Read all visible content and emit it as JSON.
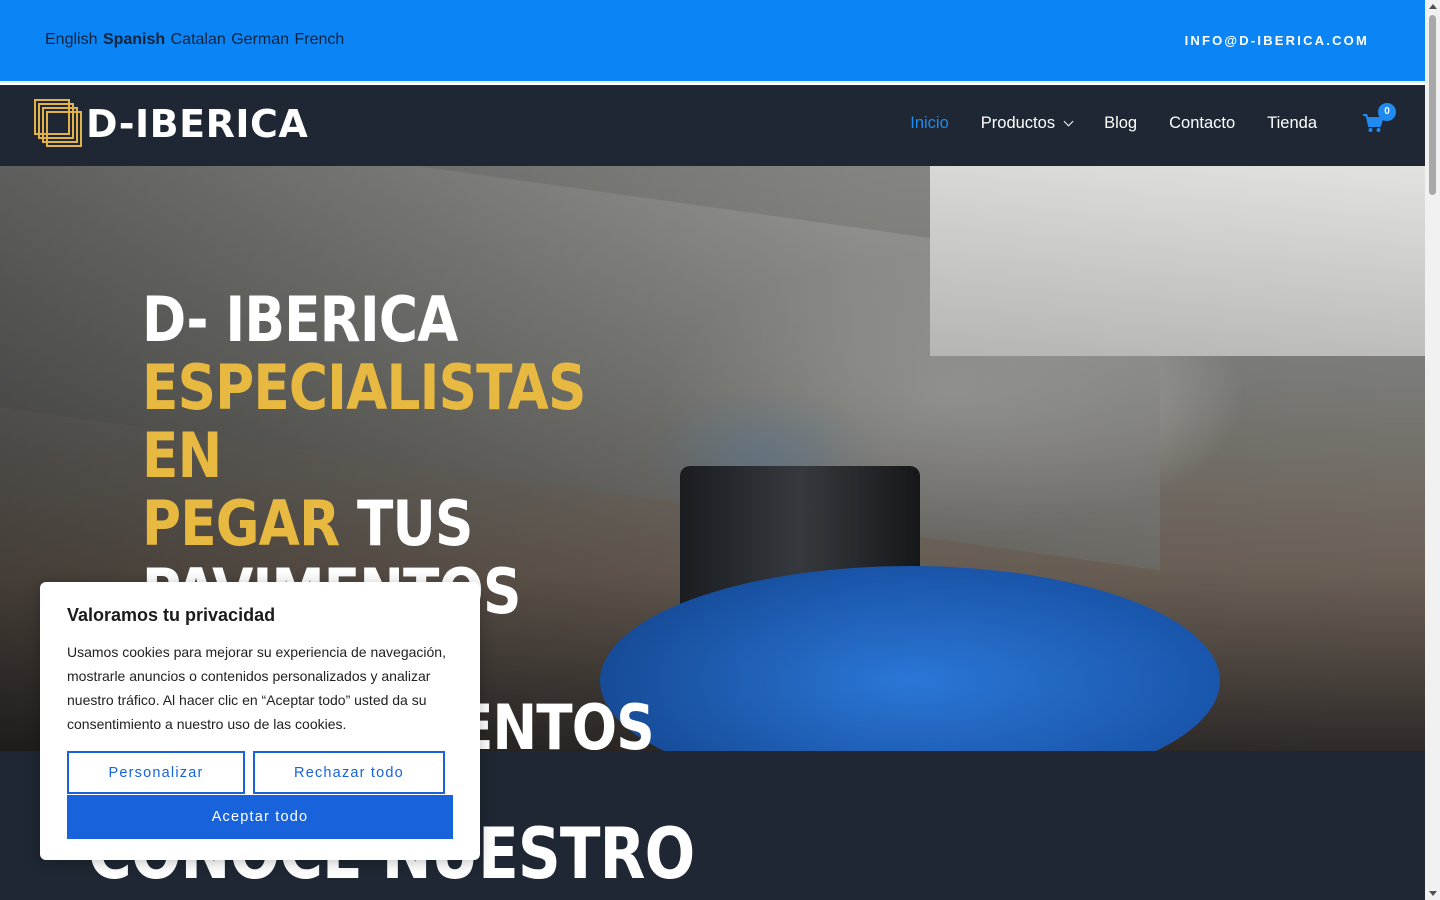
{
  "topbar": {
    "languages": [
      "English",
      "Spanish",
      "Catalan",
      "German",
      "French"
    ],
    "active_language": "Spanish",
    "email": "INFO@D-IBERICA.COM"
  },
  "header": {
    "logo_text": "D-IBERICA",
    "nav": [
      "Inicio",
      "Productos",
      "Blog",
      "Contacto",
      "Tienda"
    ],
    "current": "Inicio",
    "cart_count": "0"
  },
  "hero": {
    "line1": "D- IBERICA",
    "gold1": "ESPECIALISTAS EN",
    "gold2": "PEGAR",
    "white2": " TUS",
    "line3": "PAVIMENTOS Y",
    "line4": "REVESTIMIENTOS"
  },
  "section": {
    "title": "CONOCE NUESTRO"
  },
  "cookie": {
    "title": "Valoramos tu privacidad",
    "text": "Usamos cookies para mejorar su experiencia de navegación, mostrarle anuncios o contenidos personalizados y analizar nuestro tráfico. Al hacer clic en “Aceptar todo” usted da su consentimiento a nuestro uso de las cookies.",
    "customize": "Personalizar",
    "reject": "Rechazar todo",
    "accept": "Aceptar todo"
  },
  "colors": {
    "topbar": "#0b84f5",
    "header": "#1e2733",
    "accent": "#1f8bf0",
    "gold": "#e8b940",
    "cookie_button": "#1863dc"
  }
}
